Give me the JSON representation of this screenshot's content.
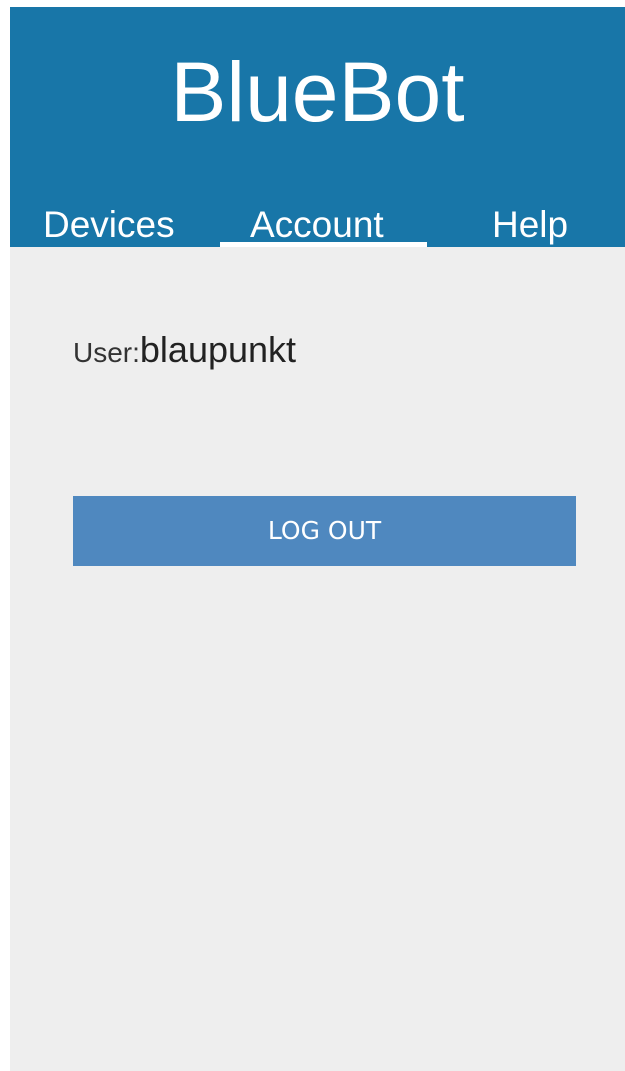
{
  "app": {
    "title": "BlueBot"
  },
  "tabs": [
    {
      "label": "Devices",
      "active": false
    },
    {
      "label": "Account",
      "active": true
    },
    {
      "label": "Help",
      "active": false
    }
  ],
  "account": {
    "user_label": "User:",
    "username": "blaupunkt",
    "logout_label": "LOG OUT"
  },
  "colors": {
    "header_background": "#1876a8",
    "button_background": "#4f88bf",
    "page_background": "#eeeeee",
    "header_text": "#ffffff"
  }
}
